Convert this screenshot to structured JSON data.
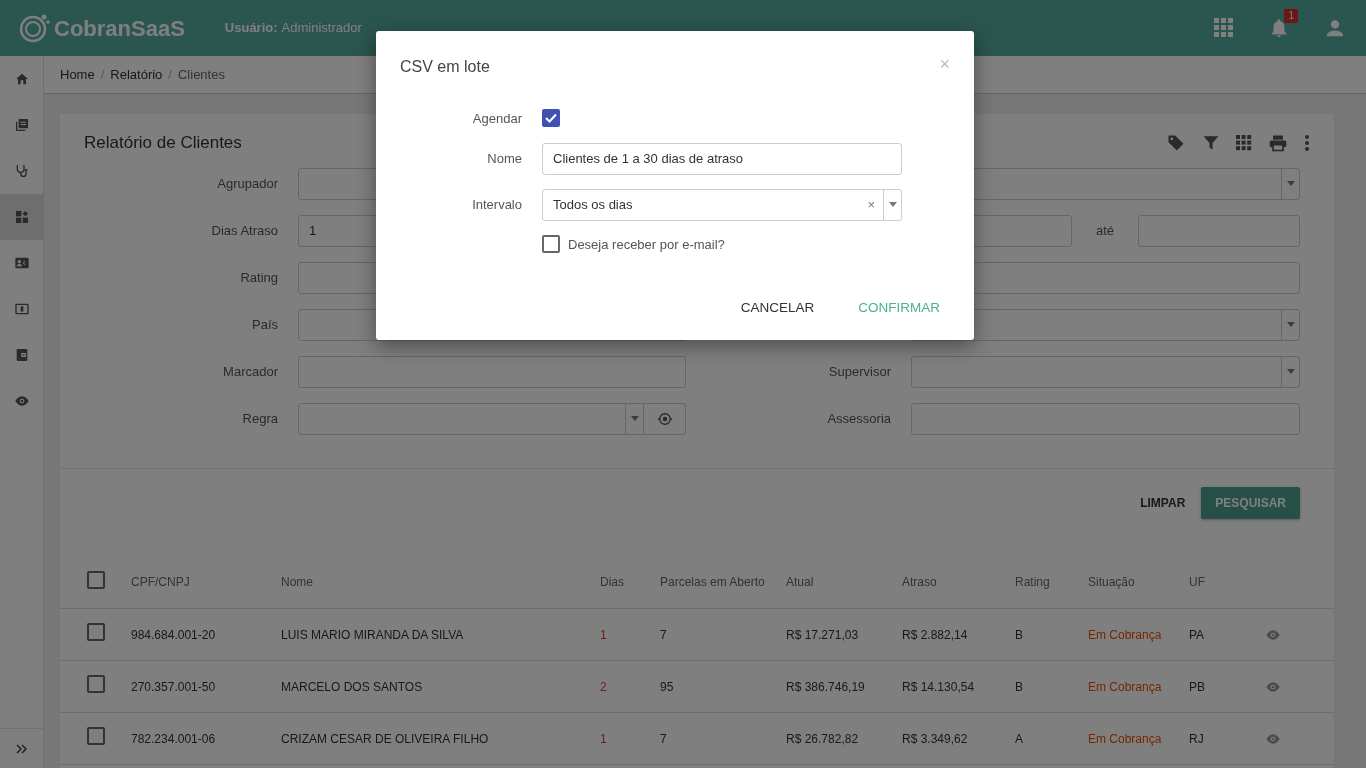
{
  "header": {
    "logo": "CobranSaaS",
    "user_label": "Usuário:",
    "user_value": "Administrador",
    "notification_count": "1"
  },
  "sidebar": {
    "items": [
      {
        "selected": false
      },
      {
        "selected": false
      },
      {
        "selected": false
      },
      {
        "selected": true
      },
      {
        "selected": false
      },
      {
        "selected": false
      },
      {
        "selected": false
      },
      {
        "selected": false
      }
    ]
  },
  "breadcrumb": [
    {
      "label": "Home",
      "current": false
    },
    {
      "separator": "/",
      "label": "Relatório",
      "current": false
    },
    {
      "separator": "/",
      "label": "Clientes",
      "current": true
    }
  ],
  "report": {
    "title": "Relatório de Clientes",
    "form_left": [
      {
        "label": "Agrupador",
        "kind": "input"
      },
      {
        "label": "Dias Atraso",
        "kind": "input",
        "value": "1"
      },
      {
        "label": "Rating",
        "kind": "input"
      },
      {
        "label": "País",
        "kind": "input"
      },
      {
        "label": "Marcador",
        "kind": "input"
      },
      {
        "label": "Regra",
        "kind": "select_button"
      }
    ],
    "form_right": [
      {
        "kind": "select"
      },
      {
        "kind": "range",
        "between_label": "até"
      },
      {
        "kind": "input"
      },
      {
        "kind": "select"
      },
      {
        "label": "Supervisor",
        "kind": "select"
      },
      {
        "label": "Assessoria",
        "kind": "input"
      }
    ],
    "buttons": [
      {
        "label": "LIMPAR",
        "primary": false
      },
      {
        "label": "PESQUISAR",
        "primary": true
      }
    ]
  },
  "table": {
    "header_checked": false,
    "columns": [
      "CPF/CNPJ",
      "Nome",
      "Dias",
      "Parcelas em Aberto",
      "Atual",
      "Atraso",
      "Rating",
      "Situação",
      "UF"
    ],
    "rows": [
      {
        "checked": false,
        "cells": [
          "984.684.001-20",
          "LUIS MARIO MIRANDA DA SILVA",
          "1",
          "7",
          "R$ 17.271,03",
          "R$ 2.882,14",
          "B",
          "Em Cobrança",
          "PA"
        ]
      },
      {
        "checked": false,
        "cells": [
          "270.357.001-50",
          "MARCELO DOS SANTOS",
          "2",
          "95",
          "R$ 386.746,19",
          "R$ 14.130,54",
          "B",
          "Em Cobrança",
          "PB"
        ]
      },
      {
        "checked": false,
        "cells": [
          "782.234.001-06",
          "CRIZAM CESAR DE OLIVEIRA FILHO",
          "1",
          "7",
          "R$ 26.782,82",
          "R$ 3.349,62",
          "A",
          "Em Cobrança",
          "RJ"
        ]
      }
    ]
  },
  "modal": {
    "title": "CSV em lote",
    "close": "×",
    "fields": [
      {
        "kind": "checkbox",
        "label": "Agendar",
        "checked": true
      },
      {
        "kind": "input",
        "label": "Nome",
        "value": "Clientes de 1 a 30 dias de atraso"
      },
      {
        "kind": "select",
        "label": "Intervalo",
        "value": "Todos os dias",
        "clear": "×"
      },
      {
        "kind": "check_option",
        "text": "Deseja receber por e-mail?",
        "checked": false
      }
    ],
    "buttons": [
      {
        "label": "CANCELAR",
        "primary": false
      },
      {
        "label": "CONFIRMAR",
        "primary": true
      }
    ]
  }
}
